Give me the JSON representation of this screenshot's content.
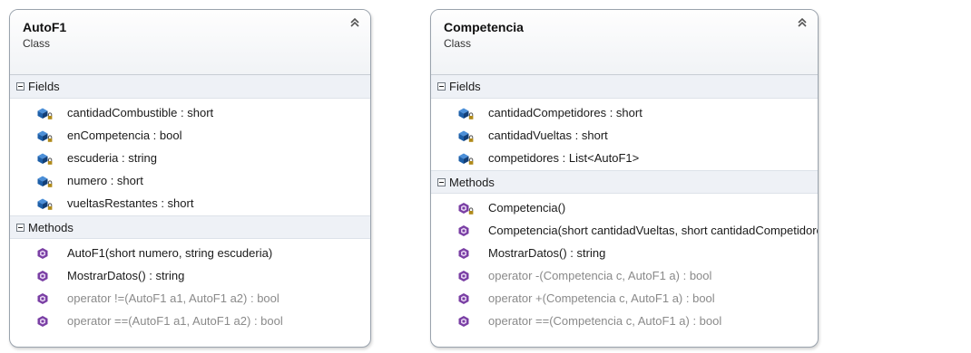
{
  "classes": [
    {
      "name": "AutoF1",
      "stereotype": "Class",
      "fields_label": "Fields",
      "methods_label": "Methods",
      "fields": [
        "cantidadCombustible : short",
        "enCompetencia : bool",
        "escuderia : string",
        "numero : short",
        "vueltasRestantes : short"
      ],
      "methods": [
        "AutoF1(short numero, string escuderia)",
        "MostrarDatos() : string",
        "operator !=(AutoF1 a1, AutoF1 a2) : bool",
        "operator ==(AutoF1 a1, AutoF1 a2) : bool"
      ]
    },
    {
      "name": "Competencia",
      "stereotype": "Class",
      "fields_label": "Fields",
      "methods_label": "Methods",
      "fields": [
        "cantidadCompetidores : short",
        "cantidadVueltas : short",
        "competidores : List<AutoF1>"
      ],
      "methods": [
        "Competencia()",
        "Competencia(short cantidadVueltas, short cantidadCompetidores)",
        "MostrarDatos() : string",
        "operator -(Competencia c, AutoF1 a) : bool",
        "operator +(Competencia c, AutoF1 a) : bool",
        "operator ==(Competencia c, AutoF1 a) : bool"
      ]
    }
  ],
  "icons": {
    "header_button": "double-chevron-up-icon",
    "section_toggle": "collapse-minus-icon",
    "private_field": "private-field-icon",
    "public_method": "public-method-icon",
    "private_method": "private-method-icon"
  },
  "colors": {
    "field_icon": "#1d5fa8",
    "method_icon": "#7a3fa4",
    "lock": "#b08a1a",
    "operator_text": "#8a8a8a",
    "section_bg": "#eef1f6",
    "border": "#9aa3ad"
  }
}
